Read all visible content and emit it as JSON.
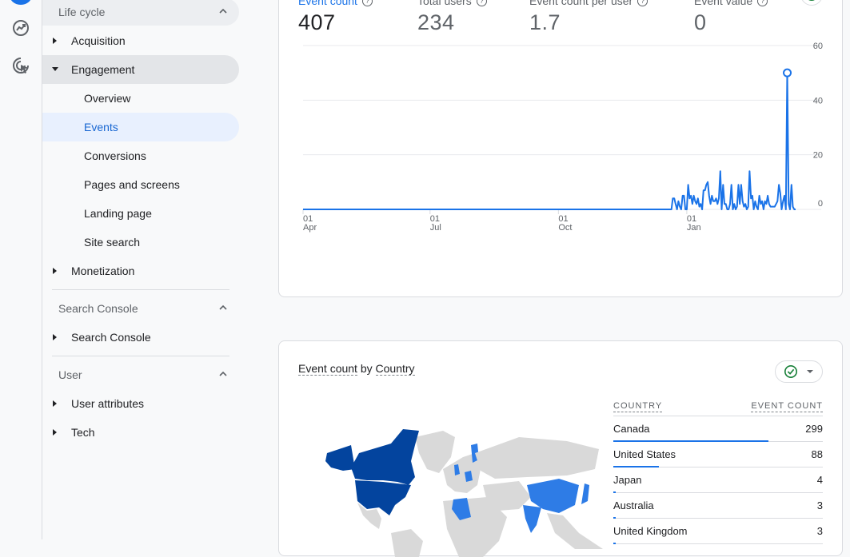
{
  "rail": {
    "icons": [
      "home-icon",
      "reports-icon",
      "explore-icon",
      "advertising-icon"
    ]
  },
  "nav": {
    "sections": [
      {
        "title": "Life cycle",
        "items": [
          {
            "label": "Acquisition",
            "level": 1,
            "expandable": true,
            "expanded": false
          },
          {
            "label": "Engagement",
            "level": 1,
            "expandable": true,
            "expanded": true
          },
          {
            "label": "Overview",
            "level": 2
          },
          {
            "label": "Events",
            "level": 2,
            "selected": true
          },
          {
            "label": "Conversions",
            "level": 2
          },
          {
            "label": "Pages and screens",
            "level": 2
          },
          {
            "label": "Landing page",
            "level": 2
          },
          {
            "label": "Site search",
            "level": 2
          },
          {
            "label": "Monetization",
            "level": 1,
            "expandable": true,
            "expanded": false
          }
        ]
      },
      {
        "title": "Search Console",
        "items": [
          {
            "label": "Search Console",
            "level": 1,
            "expandable": true,
            "expanded": false
          }
        ]
      },
      {
        "title": "User",
        "items": [
          {
            "label": "User attributes",
            "level": 1,
            "expandable": true,
            "expanded": false
          },
          {
            "label": "Tech",
            "level": 1,
            "expandable": true,
            "expanded": false
          }
        ]
      }
    ]
  },
  "metrics": [
    {
      "label": "Event count",
      "value": "407",
      "active": true
    },
    {
      "label": "Total users",
      "value": "234",
      "active": false
    },
    {
      "label": "Event count per user",
      "value": "1.7",
      "active": false
    },
    {
      "label": "Event value",
      "value": "0",
      "active": false
    }
  ],
  "colors": {
    "accent": "#1a73e8",
    "dark_blue": "#03449e",
    "mid_blue": "#2e7ce6",
    "land_gray": "#d9d9d9",
    "check_green": "#188038"
  },
  "chart_data": {
    "type": "line",
    "title": "",
    "xlabel": "",
    "ylabel": "",
    "ylim": [
      0,
      60
    ],
    "yticks": [
      0,
      20,
      40,
      60
    ],
    "grid": true,
    "x_tick_labels": [
      {
        "day": "01",
        "month": "Apr",
        "index": 0
      },
      {
        "day": "01",
        "month": "Jul",
        "index": 91
      },
      {
        "day": "01",
        "month": "Oct",
        "index": 183
      },
      {
        "day": "01",
        "month": "Jan",
        "index": 275
      }
    ],
    "series": [
      {
        "name": "Event count",
        "start_index": 0,
        "zero_until_index": 265,
        "tail_values": [
          4,
          4,
          2,
          0,
          3,
          1,
          0,
          5,
          5,
          0,
          0,
          9,
          4,
          5,
          2,
          5,
          3,
          2,
          4,
          1,
          2,
          0,
          7,
          7,
          9,
          10,
          5,
          2,
          5,
          3,
          3,
          4,
          2,
          4,
          14,
          0,
          9,
          2,
          2,
          0,
          0,
          2,
          9,
          0,
          2,
          0,
          1,
          9,
          2,
          9,
          3,
          1,
          2,
          0,
          1,
          14,
          4,
          5,
          0,
          3,
          1,
          0,
          5,
          2,
          3,
          0,
          3,
          2,
          5,
          2,
          1,
          1,
          1,
          1,
          2,
          3,
          9,
          6,
          0,
          3,
          5,
          0,
          50,
          2,
          0,
          9,
          1,
          0,
          0
        ],
        "highlight": {
          "index": 347,
          "value": 50
        }
      }
    ]
  },
  "country_card": {
    "title_metric": "Event count",
    "title_by": "by",
    "title_dimension": "Country",
    "table_headers": [
      "COUNTRY",
      "EVENT COUNT"
    ],
    "rows": [
      {
        "country": "Canada",
        "value": 299
      },
      {
        "country": "United States",
        "value": 88
      },
      {
        "country": "Japan",
        "value": 4
      },
      {
        "country": "Australia",
        "value": 3
      },
      {
        "country": "United Kingdom",
        "value": 3
      }
    ],
    "map_highlight_dark": [
      "Canada",
      "United States"
    ],
    "map_highlight_light": [
      "United Kingdom",
      "Finland",
      "Germany",
      "Algeria",
      "China",
      "India",
      "Japan"
    ]
  }
}
